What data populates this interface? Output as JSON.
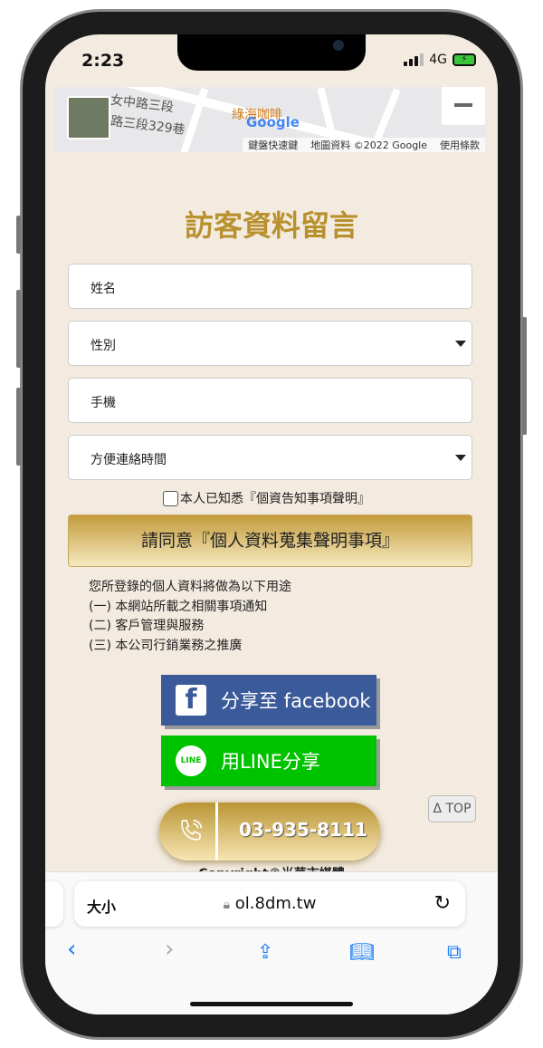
{
  "status_bar": {
    "time": "2:23",
    "network": "4G"
  },
  "map": {
    "labels": [
      "女中路三段",
      "路三段329巷",
      "綠海咖啡"
    ],
    "logo": "Google",
    "attribution": [
      "鍵盤快速鍵",
      "地圖資料 ©2022 Google",
      "使用條款"
    ],
    "zoom_out": "−"
  },
  "form": {
    "title": "訪客資料留言",
    "name_placeholder": "姓名",
    "gender_placeholder": "性別",
    "mobile_placeholder": "手機",
    "contact_time_placeholder": "方便連絡時間",
    "agree_label": "本人已知悉『個資告知事項聲明』",
    "consent_button": "請同意『個人資料蒐集聲明事項』",
    "uses": [
      "您所登錄的個人資料將做為以下用途",
      "(一) 本網站所載之相關事項通知",
      "(二) 客戶管理與服務",
      "(三) 本公司行銷業務之推廣"
    ]
  },
  "share": {
    "facebook": "分享至 facebook",
    "line": "用LINE分享",
    "line_icon_text": "LINE"
  },
  "contact": {
    "phone": "03-935-8111"
  },
  "back_to_top": "Δ TOP",
  "footer": {
    "copyright": "Copyright©光華市媒體"
  },
  "browser": {
    "text_size": "大小",
    "domain": "ol.8dm.tw"
  },
  "colors": {
    "background": "#f3ebe0",
    "gold": "#b8912e",
    "facebook": "#3b5a9a",
    "line": "#00c300",
    "ios_blue": "#1a7cf5"
  }
}
